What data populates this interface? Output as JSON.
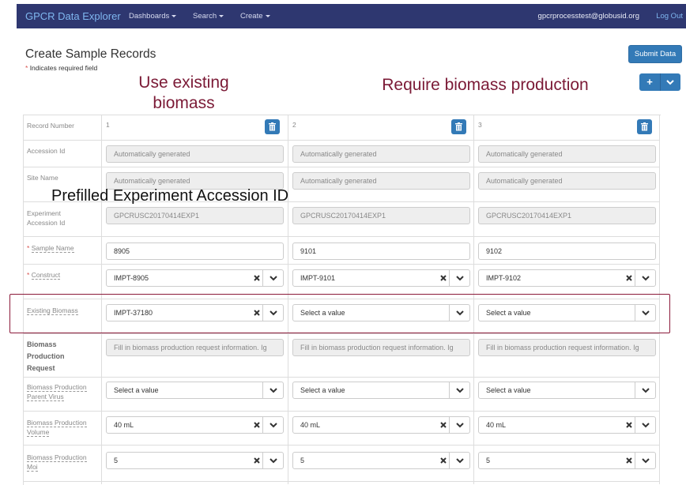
{
  "navbar": {
    "brand": "GPCR Data Explorer",
    "menus": [
      "Dashboards",
      "Search",
      "Create"
    ],
    "user_email": "gpcrprocesstest@globusid.org",
    "logout": "Log Out"
  },
  "page": {
    "title": "Create Sample Records",
    "required_note": "Indicates required field",
    "required_star": "*",
    "submit": "Submit Data"
  },
  "annotations": {
    "use_existing": "Use existing biomass",
    "require_biomass": "Require biomass production",
    "prefilled": "Prefilled Experiment Accession ID"
  },
  "labels": {
    "record_number": "Record Number",
    "accession_id": "Accession Id",
    "site_name": "Site Name",
    "experiment_accession_id": "Experiment Accession Id",
    "sample_name": "Sample Name",
    "construct": "Construct",
    "existing_biomass": "Existing Biomass",
    "biomass_production_request": "Biomass Production Request",
    "biomass_production_parent_virus": "Biomass Production Parent Virus",
    "biomass_production_volume": "Biomass Production Volume",
    "biomass_production_moi": "Biomass Production Moi"
  },
  "records": [
    {
      "number": "1",
      "accession_id": "Automatically generated",
      "site_name": "Automatically generated",
      "experiment_accession_id": "GPCRUSC20170414EXP1",
      "sample_name": "8905",
      "construct": "IMPT-8905",
      "existing_biomass": "IMPT-37180",
      "biomass_request": "Fill in biomass production request information. Ig",
      "parent_virus": "Select a value",
      "volume": "40 mL",
      "moi": "5"
    },
    {
      "number": "2",
      "accession_id": "Automatically generated",
      "site_name": "Automatically generated",
      "experiment_accession_id": "GPCRUSC20170414EXP1",
      "sample_name": "9101",
      "construct": "IMPT-9101",
      "existing_biomass": "Select a value",
      "biomass_request": "Fill in biomass production request information. Ig",
      "parent_virus": "Select a value",
      "volume": "40 mL",
      "moi": "5"
    },
    {
      "number": "3",
      "accession_id": "Automatically generated",
      "site_name": "Automatically generated",
      "experiment_accession_id": "GPCRUSC20170414EXP1",
      "sample_name": "9102",
      "construct": "IMPT-9102",
      "existing_biomass": "Select a value",
      "biomass_request": "Fill in biomass production request information. Ig",
      "parent_virus": "Select a value",
      "volume": "40 mL",
      "moi": "5"
    }
  ],
  "colors": {
    "navbar": "#2e3770",
    "brand_link": "#7fb7f0",
    "primary_button": "#337ab7",
    "annotation": "#7b1a36",
    "required": "#d9534f"
  }
}
